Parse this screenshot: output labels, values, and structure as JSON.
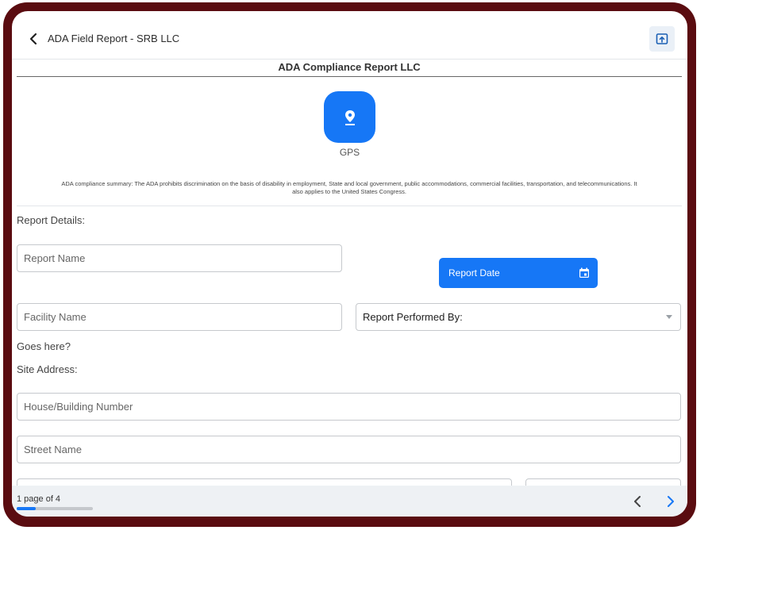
{
  "header": {
    "title": "ADA Field Report - SRB LLC",
    "report_title": "ADA Compliance Report LLC"
  },
  "icons": {
    "back": "chevron-left-icon",
    "share": "open-in-new-icon",
    "gps": "location-pin-icon",
    "calendar": "calendar-icon",
    "dropdown": "caret-down-icon",
    "prev": "chevron-left-icon",
    "next": "chevron-right-icon"
  },
  "colors": {
    "accent": "#1677f6",
    "device_frame": "#5a0c10"
  },
  "gps": {
    "label": "GPS"
  },
  "summary": {
    "line1": "ADA compliance summary:  The ADA prohibits discrimination on the basis of disability in employment,  State and local government, public    accommodations, commercial facilities,  transportation, and telecommunications.  It",
    "line2": "also applies to the United States Congress."
  },
  "form": {
    "report_details_label": "Report Details:",
    "report_name_placeholder": "Report Name",
    "report_date_label": "Report Date",
    "facility_name_placeholder": "Facility Name",
    "performed_by_label": "Report Performed By:",
    "goes_here": "Goes here?",
    "site_address_label": "Site Address:",
    "house_number_placeholder": "House/Building Number",
    "street_name_placeholder": "Street Name"
  },
  "footer": {
    "page_text": "1 page of 4",
    "progress": 0.25
  }
}
